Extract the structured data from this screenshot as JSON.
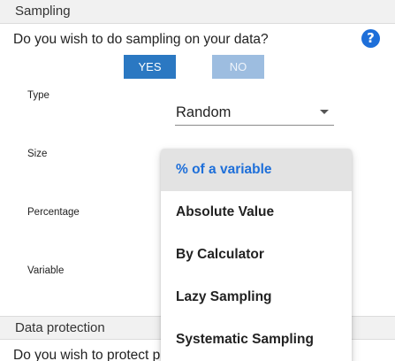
{
  "sampling": {
    "header": "Sampling",
    "question": "Do you wish to do sampling on your data?",
    "help_icon": "?",
    "yes_label": "YES",
    "no_label": "NO",
    "selected_toggle": "YES",
    "fields": {
      "type_label": "Type",
      "size_label": "Size",
      "percentage_label": "Percentage",
      "variable_label": "Variable"
    },
    "type_select": {
      "value": "Random",
      "icon": "caret-down-icon"
    },
    "size_menu": {
      "options": [
        "% of a variable",
        "Absolute Value",
        "By Calculator",
        "Lazy Sampling",
        "Systematic Sampling"
      ],
      "highlighted": "% of a variable"
    }
  },
  "data_protection": {
    "header": "Data protection",
    "question_partial": "Do you wish to protect p"
  },
  "colors": {
    "accent": "#2b78c2",
    "accent_disabled": "#9dbde0",
    "highlight_text": "#1e6fd9"
  }
}
